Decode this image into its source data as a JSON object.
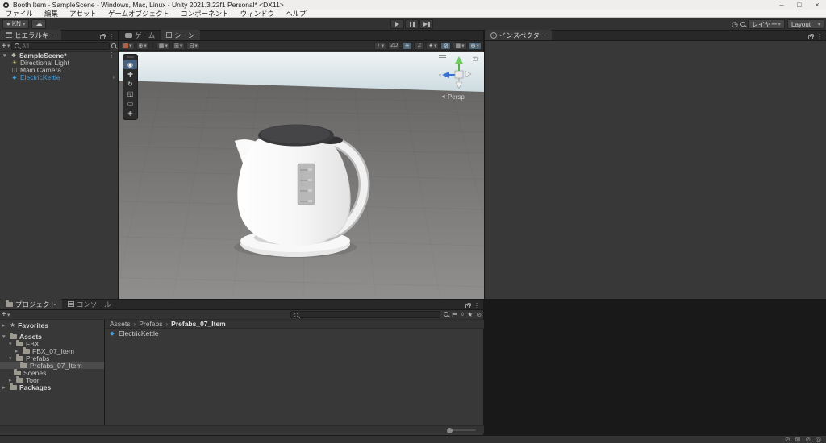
{
  "window": {
    "title": "Booth Item - SampleScene - Windows, Mac, Linux - Unity 2021.3.22f1 Personal* <DX11>",
    "minimize": "–",
    "maximize": "□",
    "close": "×"
  },
  "menu_bar": {
    "items": [
      "ファイル",
      "編集",
      "アセット",
      "ゲームオブジェクト",
      "コンポーネント",
      "ウィンドウ",
      "ヘルプ"
    ]
  },
  "main_toolbar": {
    "account_label": "KN",
    "cloud_icon": "☁",
    "history_icon": "◷",
    "layers_label": "レイヤー",
    "layout_label": "Layout"
  },
  "hierarchy": {
    "tab_label": "ヒエラルキー",
    "add_label": "+",
    "search_text": "All",
    "scene_row": {
      "label": "SampleScene*"
    },
    "children": [
      {
        "label": "Directional Light",
        "icon": "light"
      },
      {
        "label": "Main Camera",
        "icon": "camera"
      },
      {
        "label": "ElectricKettle",
        "icon": "prefab"
      }
    ]
  },
  "scene": {
    "game_tab_label": "ゲーム",
    "scene_tab_label": "シーン",
    "toolbar": {
      "render_mode_icon": "◐",
      "two_d_label": "2D",
      "lighting_icon": "☀",
      "audio_icon": "♫",
      "effects_icon": "✦",
      "hidden_icon": "⊘",
      "grid_icon": "▦",
      "camera_icon": "⊕",
      "globe_icon": "⊕",
      "snap_icon": "▦",
      "increment_icon": "⊞",
      "snap2_icon": "⊟"
    },
    "tools": [
      "view",
      "move",
      "rotate",
      "scale",
      "rect",
      "transform"
    ],
    "gizmo": {
      "axis_x_label": "x",
      "persp_label": "Persp",
      "persp_arrow": "◄"
    }
  },
  "inspector": {
    "tab_label": "インスペクター"
  },
  "project": {
    "tab_label": "プロジェクト",
    "console_tab_label": "コンソール",
    "add_label": "+",
    "favorites_label": "Favorites",
    "tree": [
      {
        "label": "Assets"
      },
      {
        "label": "FBX"
      },
      {
        "label": "FBX_07_Item"
      },
      {
        "label": "Prefabs"
      },
      {
        "label": "Prefabs_07_Item"
      },
      {
        "label": "Scenes"
      },
      {
        "label": "Toon"
      },
      {
        "label": "Packages"
      }
    ],
    "breadcrumb": {
      "root": "Assets",
      "mid": "Prefabs",
      "current": "Prefabs_07_Item"
    },
    "items": [
      {
        "label": "ElectricKettle"
      }
    ]
  },
  "status_bar": {
    "icons": [
      "⊘",
      "⊠",
      "⊘",
      "◎"
    ]
  },
  "colors": {
    "prefab_blue": "#4a9eda",
    "selection_gray": "#4c4c4c",
    "toggle_on_blue": "#4c6374",
    "sky_top": "#f0f5f6",
    "sky_bottom": "#c3d3d9",
    "ground": "#6e6c6a"
  }
}
